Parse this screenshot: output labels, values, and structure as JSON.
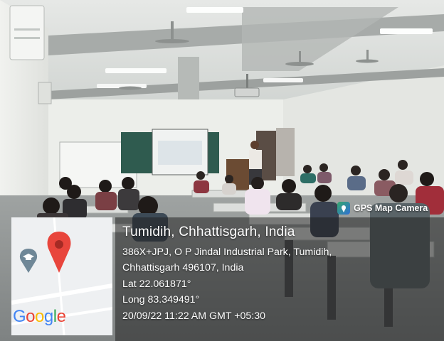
{
  "gps_camera_label": "GPS Map Camera",
  "location": {
    "title": "Tumidih, Chhattisgarh, India",
    "address_line1": "386X+JPJ, O P Jindal Industrial Park, Tumidih,",
    "address_line2": "Chhattisgarh 496107, India",
    "latitude": "Lat 22.061871°",
    "longitude": "Long 83.349491°",
    "datetime": "20/09/22 11:22 AM GMT +05:30"
  },
  "map_logo": "Google",
  "map_logo_colors": [
    "#4285F4",
    "#EA4335",
    "#FBBC05",
    "#4285F4",
    "#34A853",
    "#EA4335"
  ],
  "icons": [
    "gps-map-camera-icon",
    "map-pin-icon",
    "graduation-cap-pin-icon",
    "projector-icon",
    "ceiling-fan-icon",
    "air-conditioner-icon"
  ]
}
